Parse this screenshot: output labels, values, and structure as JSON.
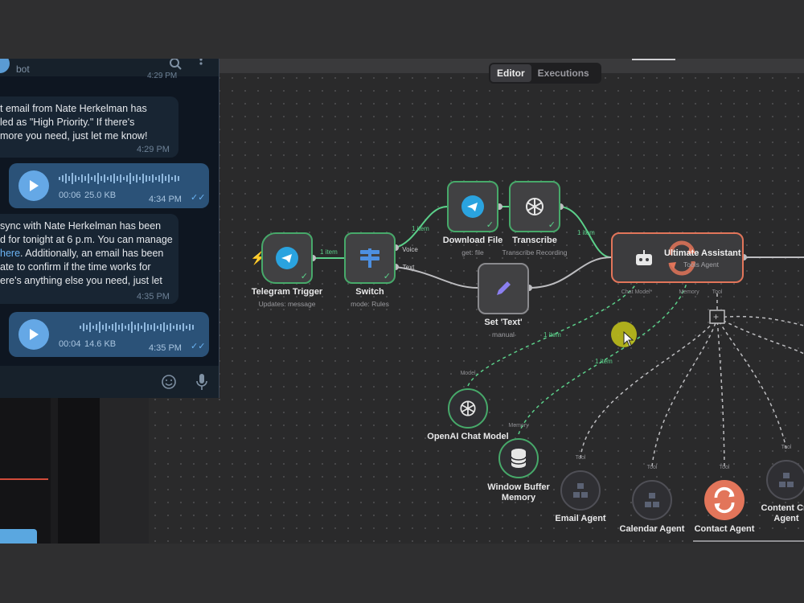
{
  "editor": {
    "tabs": [
      {
        "label": "Editor",
        "active": true
      },
      {
        "label": "Executions",
        "active": false
      }
    ]
  },
  "chat": {
    "bot_name": "bot",
    "header_time": "4:29 PM",
    "messages": [
      {
        "type": "text",
        "lines": [
          "t email from Nate Herkelman has",
          "led as \"High Priority.\" If there's",
          "more you need, just let me know!"
        ],
        "time": "4:29 PM"
      },
      {
        "type": "voice",
        "duration": "00:06",
        "size": "25.0 KB",
        "time": "4:34 PM"
      },
      {
        "type": "text",
        "lines": [
          " sync with Nate Herkelman has been",
          "d for tonight at 6 p.m. You can manage",
          "here",
          ". Additionally, an email has been",
          "ate to confirm if the time works for",
          "ere's anything else you need, just let"
        ],
        "time": "4:35 PM"
      },
      {
        "type": "voice",
        "duration": "00:04",
        "size": "14.6 KB",
        "time": "4:35 PM"
      }
    ]
  },
  "workflow": {
    "nodes": {
      "telegram_trigger": {
        "name": "Telegram Trigger",
        "sub": "Updates: message"
      },
      "switch": {
        "name": "Switch",
        "sub": "mode: Rules",
        "outputs": [
          "Voice",
          "Text"
        ]
      },
      "download_file": {
        "name": "Download File",
        "sub": "get: file"
      },
      "transcribe": {
        "name": "Transcribe",
        "sub": "Transcribe Recording"
      },
      "set_text": {
        "name": "Set 'Text'",
        "sub": "manual"
      },
      "ultimate_assistant": {
        "name": "Ultimate Assistant",
        "sub": "Tools Agent",
        "ports": [
          "Chat Model*",
          "Memory",
          "Tool"
        ]
      },
      "openai_chat_model": {
        "name": "OpenAI Chat Model",
        "port": "Model"
      },
      "window_buffer_memory": {
        "name": "Window Buffer Memory",
        "port": "Memory"
      },
      "email_agent": {
        "name": "Email Agent",
        "port": "Tool"
      },
      "calendar_agent": {
        "name": "Calendar Agent",
        "port": "Tool"
      },
      "contact_agent": {
        "name": "Contact Agent",
        "port": "Tool"
      },
      "content_agent": {
        "name": "Content Cre Agent",
        "port": "Tool"
      }
    },
    "edge_labels": [
      "1 item",
      "1 item",
      "1 item",
      "1 item",
      "1 item",
      "1 item"
    ]
  },
  "icons": [
    "search-icon",
    "menu-icon",
    "play-icon",
    "smiley-icon",
    "microphone-icon",
    "telegram-icon",
    "switch-icon",
    "openai-icon",
    "pencil-icon",
    "robot-icon",
    "database-icon",
    "agent-icon",
    "refresh-icon",
    "bolt-icon",
    "plus-icon",
    "read-check-icon"
  ],
  "colors": {
    "success": "#47a96a",
    "accent_red": "#e2755a",
    "telegram_blue": "#65a8e6"
  }
}
